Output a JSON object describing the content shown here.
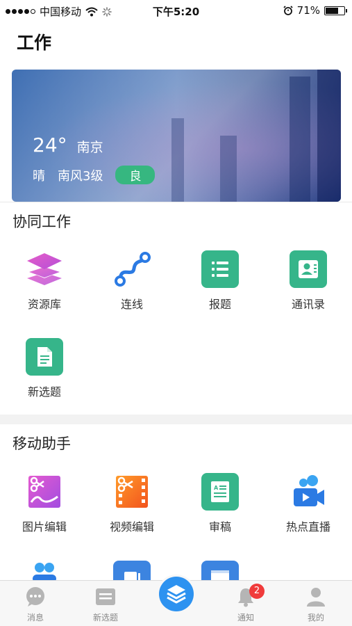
{
  "status_bar": {
    "carrier": "中国移动",
    "time": "下午5:20",
    "battery_percent": "71%",
    "battery_level": 0.71
  },
  "page": {
    "title": "工作"
  },
  "weather": {
    "temperature": "24°",
    "city": "南京",
    "condition": "晴",
    "wind": "南风3级",
    "air_quality": "良",
    "air_quality_color": "#36b780"
  },
  "collab": {
    "title": "协同工作",
    "items": [
      {
        "label": "资源库",
        "icon": "layers-stack-icon"
      },
      {
        "label": "连线",
        "icon": "connection-line-icon"
      },
      {
        "label": "报题",
        "icon": "list-icon"
      },
      {
        "label": "通讯录",
        "icon": "contact-card-icon"
      },
      {
        "label": "新选题",
        "icon": "document-icon"
      }
    ]
  },
  "mobile": {
    "title": "移动助手",
    "items": [
      {
        "label": "图片编辑",
        "icon": "image-edit-icon"
      },
      {
        "label": "视频编辑",
        "icon": "video-edit-icon"
      },
      {
        "label": "审稿",
        "icon": "review-document-icon"
      },
      {
        "label": "热点直播",
        "icon": "live-camera-icon"
      }
    ]
  },
  "tabs": [
    {
      "label": "消息",
      "icon": "chat-bubble-icon"
    },
    {
      "label": "新选题",
      "icon": "topic-list-icon"
    },
    {
      "label": "",
      "icon": "layers-center-icon"
    },
    {
      "label": "通知",
      "icon": "bell-icon",
      "badge": "2"
    },
    {
      "label": "我的",
      "icon": "person-icon"
    }
  ],
  "colors": {
    "accent_blue": "#2d92f0",
    "green": "#36b58a",
    "badge_red": "#f03b3b"
  }
}
